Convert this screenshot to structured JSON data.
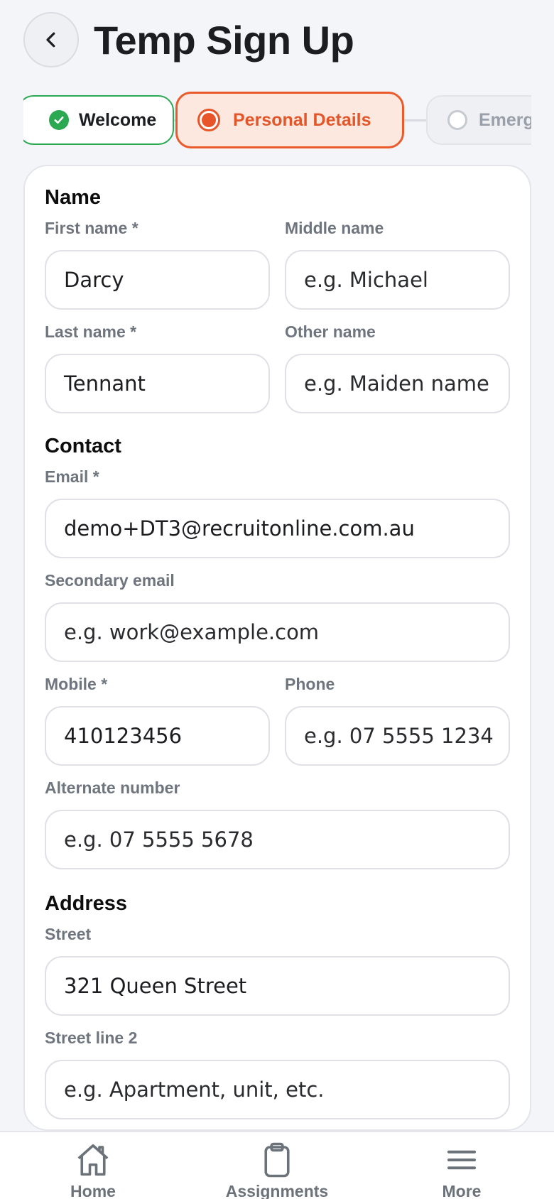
{
  "header": {
    "title": "Temp Sign Up",
    "back_icon": "chevron-left-icon"
  },
  "stepper": {
    "steps": [
      {
        "label": "Welcome",
        "status": "complete",
        "icon": "check-circle-icon"
      },
      {
        "label": "Personal Details",
        "status": "active",
        "icon": "radio-active-icon"
      },
      {
        "label": "Emerg",
        "status": "upcoming",
        "icon": "radio-empty-icon"
      }
    ]
  },
  "form": {
    "name": {
      "title": "Name",
      "first_name": {
        "label": "First name *",
        "value": "Darcy",
        "placeholder": ""
      },
      "middle_name": {
        "label": "Middle name",
        "value": "",
        "placeholder": "e.g. Michael"
      },
      "last_name": {
        "label": "Last name *",
        "value": "Tennant",
        "placeholder": ""
      },
      "other_name": {
        "label": "Other name",
        "value": "",
        "placeholder": "e.g. Maiden name"
      }
    },
    "contact": {
      "title": "Contact",
      "email": {
        "label": "Email *",
        "value": "demo+DT3@recruitonline.com.au",
        "placeholder": ""
      },
      "secondary_email": {
        "label": "Secondary email",
        "value": "",
        "placeholder": "e.g. work@example.com"
      },
      "mobile": {
        "label": "Mobile *",
        "value": "410123456",
        "placeholder": ""
      },
      "phone": {
        "label": "Phone",
        "value": "",
        "placeholder": "e.g. 07 5555 1234"
      },
      "alternate_number": {
        "label": "Alternate number",
        "value": "",
        "placeholder": "e.g. 07 5555 5678"
      }
    },
    "address": {
      "title": "Address",
      "street": {
        "label": "Street",
        "value": "321 Queen Street",
        "placeholder": ""
      },
      "street_line_2": {
        "label": "Street line 2",
        "value": "",
        "placeholder": "e.g. Apartment, unit, etc."
      }
    }
  },
  "bottom_nav": {
    "items": [
      {
        "label": "Home",
        "icon": "home-icon"
      },
      {
        "label": "Assignments",
        "icon": "clipboard-icon"
      },
      {
        "label": "More",
        "icon": "menu-icon"
      }
    ]
  },
  "colors": {
    "accent": "#ea5a2b",
    "success": "#2aa852",
    "background": "#f4f5f9",
    "label_gray": "#6f757e"
  }
}
